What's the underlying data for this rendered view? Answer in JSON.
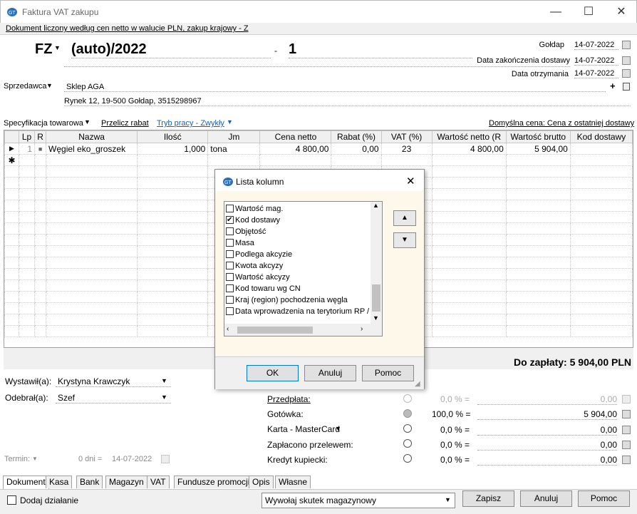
{
  "window": {
    "title": "Faktura VAT zakupu",
    "minimize": "—",
    "maximize": "☐",
    "close": "✕"
  },
  "info_line": "Dokument liczony według cen netto w walucie PLN, zakup krajowy - Z",
  "document": {
    "type": "FZ",
    "number": "(auto)/2022",
    "separator": "-",
    "suffix": "1"
  },
  "dates": [
    {
      "label": "Gołdap",
      "value": "14-07-2022"
    },
    {
      "label": "Data zakończenia dostawy",
      "value": "14-07-2022"
    },
    {
      "label": "Data otrzymania",
      "value": "14-07-2022"
    }
  ],
  "seller": {
    "label": "Sprzedawca",
    "name": "Sklep AGA",
    "address": "Rynek 12, 19-500 Gołdap, 3515298967",
    "plus": "+"
  },
  "spec_bar": {
    "spec": "Specyfikacja towarowa",
    "recalc": "Przelicz rabat",
    "mode": "Tryb pracy - Zwykły",
    "default_price": "Domyślna cena: Cena z ostatniej dostawy"
  },
  "grid": {
    "columns": [
      "",
      "Lp",
      "R",
      "Nazwa",
      "Ilość",
      "Jm",
      "Cena netto",
      "Rabat (%)",
      "VAT (%)",
      "Wartość netto (R",
      "Wartość brutto",
      "Kod dostawy"
    ],
    "rows": [
      {
        "marker": "▶",
        "lp": "1",
        "r": "■",
        "name": "Węgiel eko_groszek",
        "qty": "1,000",
        "unit": "tona",
        "price": "4 800,00",
        "discount": "0,00",
        "vat": "23",
        "net": "4 800,00",
        "gross": "5 904,00",
        "code": ""
      }
    ],
    "new_row_marker": "✱"
  },
  "total": "Do zapłaty: 5 904,00 PLN",
  "issued": {
    "label": "Wystawił(a):",
    "value": "Krystyna Krawczyk"
  },
  "received": {
    "label": "Odebrał(a):",
    "value": "Szef"
  },
  "term": {
    "label": "Termin:",
    "days": "0 dni =",
    "date": "14-07-2022"
  },
  "payments": [
    {
      "label": "Przedpłata:",
      "percent": "0,0 % =",
      "amount": "0,00",
      "selected": false,
      "disabled": true
    },
    {
      "label": "Gotówka:",
      "percent": "100,0 % =",
      "amount": "5 904,00",
      "selected": true,
      "disabled": false
    },
    {
      "label": "Karta - MasterCard",
      "percent": "0,0 % =",
      "amount": "0,00",
      "selected": false,
      "disabled": false
    },
    {
      "label": "Zapłacono przelewem:",
      "percent": "0,0 % =",
      "amount": "0,00",
      "selected": false,
      "disabled": false
    },
    {
      "label": "Kredyt kupiecki:",
      "percent": "0,0 % =",
      "amount": "0,00",
      "selected": false,
      "disabled": false
    }
  ],
  "tabs": [
    "Dokument",
    "Kasa",
    "Bank",
    "Magazyn",
    "VAT",
    "Fundusze promocji",
    "Opis",
    "Własne"
  ],
  "bottom": {
    "add_action": "Dodaj działanie",
    "warehouse_effect": "Wywołaj skutek magazynowy",
    "save": "Zapisz",
    "cancel": "Anuluj",
    "help": "Pomoc"
  },
  "dialog": {
    "title": "Lista kolumn",
    "items": [
      {
        "label": "Wartość mag.",
        "checked": false
      },
      {
        "label": "Kod dostawy",
        "checked": true
      },
      {
        "label": "Objętość",
        "checked": false
      },
      {
        "label": "Masa",
        "checked": false
      },
      {
        "label": "Podlega akcyzie",
        "checked": false
      },
      {
        "label": "Kwota akcyzy",
        "checked": false
      },
      {
        "label": "Wartość akcyzy",
        "checked": false
      },
      {
        "label": "Kod towaru wg CN",
        "checked": false
      },
      {
        "label": "Kraj (region) pochodzenia węgla",
        "checked": false
      },
      {
        "label": "Data wprowadzenia na terytorium RP /",
        "checked": false
      }
    ],
    "ok": "OK",
    "cancel": "Anuluj",
    "help": "Pomoc",
    "close": "✕"
  }
}
